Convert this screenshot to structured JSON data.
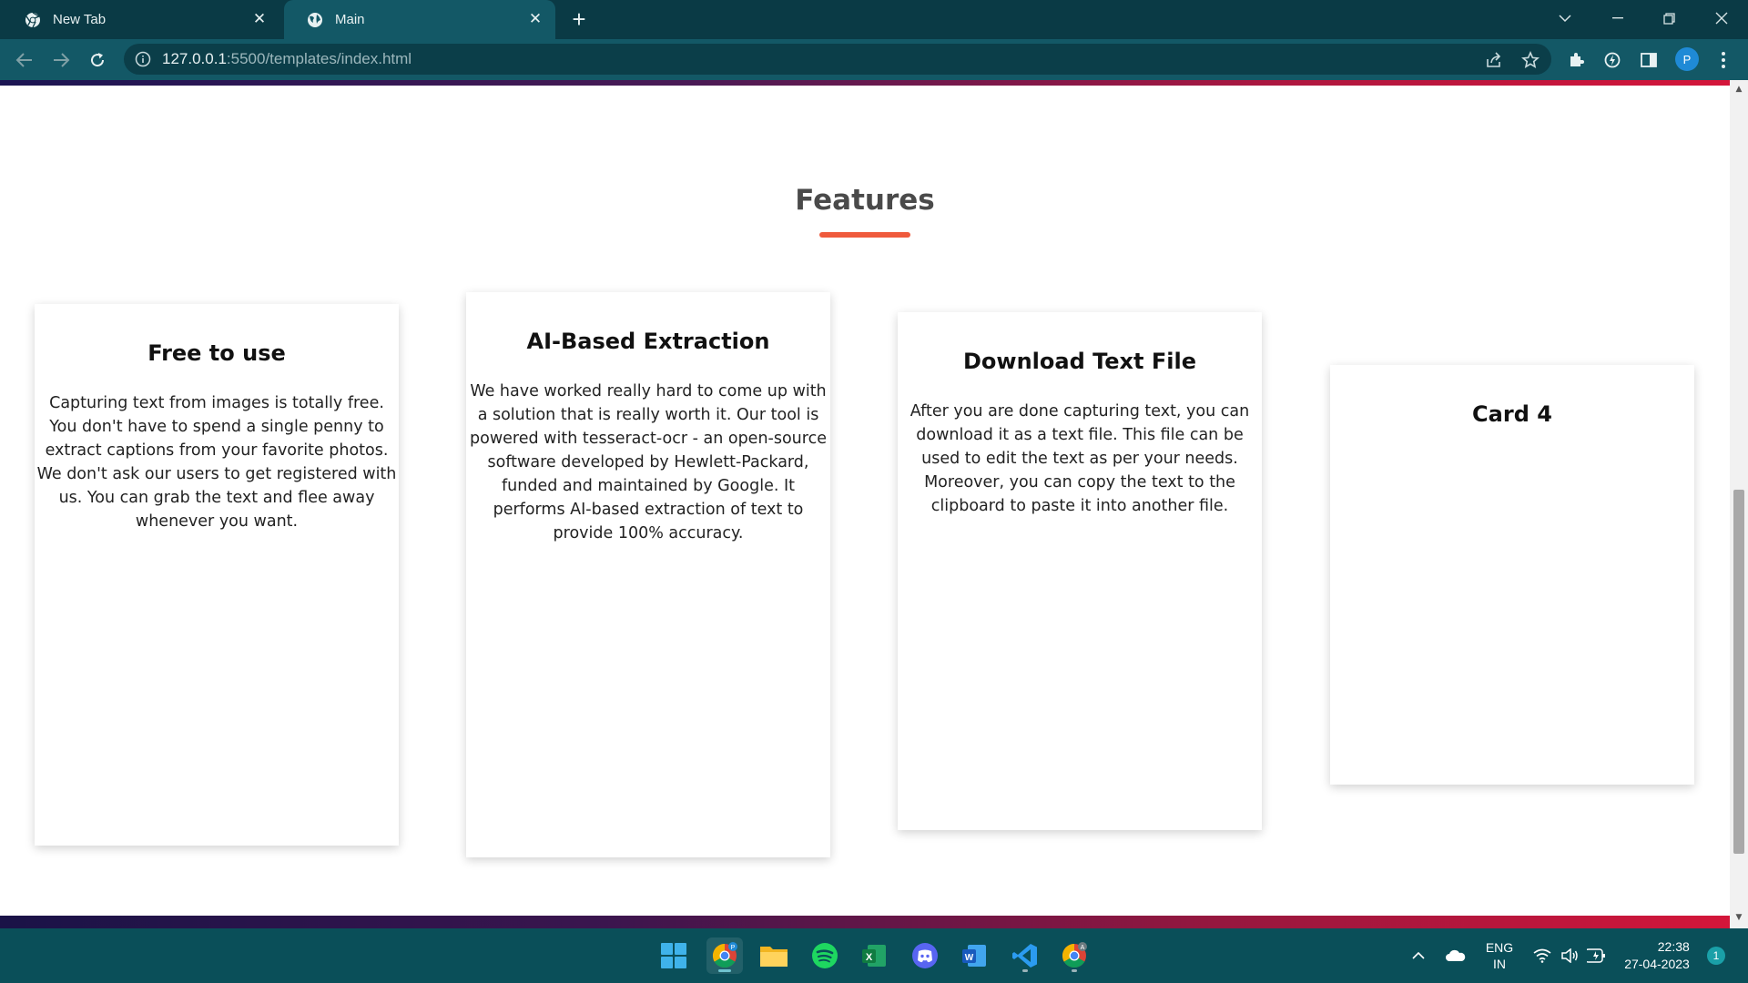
{
  "browser": {
    "tabs": [
      {
        "title": "New Tab",
        "icon": "chrome-icon",
        "active": false
      },
      {
        "title": "Main",
        "icon": "globe-icon",
        "active": true
      }
    ],
    "url_host": "127.0.0.1",
    "url_path": ":5500/templates/index.html",
    "profile_initial": "P"
  },
  "page": {
    "section_title": "Features",
    "cards": [
      {
        "title": "Free to use",
        "text": "Capturing text from images is totally free. You don't have to spend a single penny to extract captions from your favorite photos. We don't ask our users to get registered with us. You can grab the text and flee away whenever you want."
      },
      {
        "title": "AI-Based Extraction",
        "text": "We have worked really hard to come up with a solution that is really worth it. Our tool is powered with tesseract-ocr - an open-source software developed by Hewlett-Packard, funded and maintained by Google. It performs AI-based extraction of text to provide 100% accuracy."
      },
      {
        "title": "Download Text File",
        "text": "After you are done capturing text, you can download it as a text file. This file can be used to edit the text as per your needs. Moreover, you can copy the text to the clipboard to paste it into another file."
      },
      {
        "title": "Card 4",
        "text": ""
      }
    ]
  },
  "taskbar": {
    "apps": [
      "windows-start-icon",
      "chrome-icon",
      "file-explorer-icon",
      "spotify-icon",
      "excel-icon",
      "discord-icon",
      "word-icon",
      "vscode-icon",
      "chrome-alt-profile-icon"
    ],
    "lang_line1": "ENG",
    "lang_line2": "IN",
    "time": "22:38",
    "date": "27-04-2023",
    "notification_count": "1"
  },
  "colors": {
    "tabstrip": "#0a3a45",
    "toolbar": "#135866",
    "accent_underline": "#ef5a3c",
    "taskbar": "#0a4f59"
  }
}
